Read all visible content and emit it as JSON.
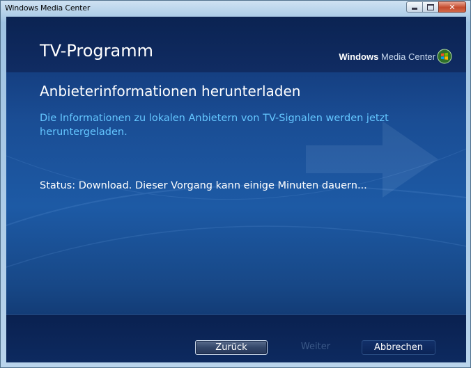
{
  "window": {
    "title": "Windows Media Center",
    "controls": [
      "minimize-icon",
      "maximize-icon",
      "close-icon"
    ]
  },
  "header": {
    "page_title": "TV-Programm",
    "brand_bold": "Windows",
    "brand_light": "Media Center"
  },
  "main": {
    "heading": "Anbieterinformationen herunterladen",
    "description": "Die Informationen zu lokalen Anbietern von TV-Signalen werden jetzt heruntergeladen.",
    "status": "Status: Download. Dieser Vorgang kann einige Minuten dauern..."
  },
  "footer": {
    "back_label": "Zurück",
    "next_label": "Weiter",
    "cancel_label": "Abbrechen"
  },
  "colors": {
    "description_text": "#64c6ff",
    "background_top": "#0f2f6c",
    "background_mid": "#1d5aa5",
    "disabled_text": "#3b5988"
  }
}
